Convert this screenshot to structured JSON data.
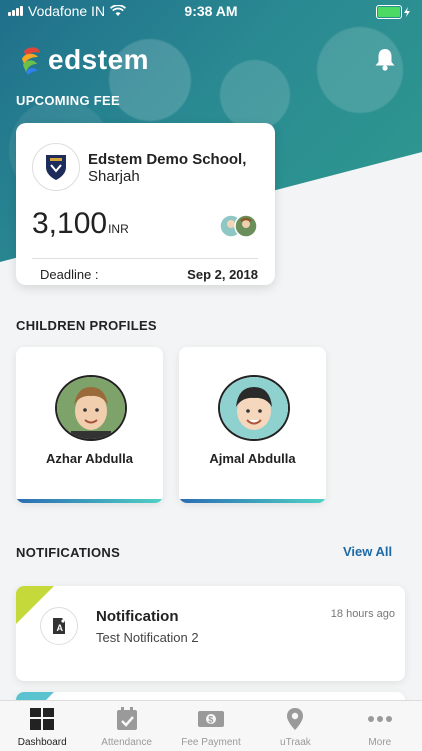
{
  "status_bar": {
    "carrier": "Vodafone IN",
    "time": "9:38 AM"
  },
  "app": {
    "name": "edstem"
  },
  "upcoming_fee": {
    "section_title": "UPCOMING FEE",
    "school_name_bold": "Edstem Demo School,",
    "school_city": "Sharjah",
    "amount": "3,100",
    "currency": "INR",
    "deadline_label": "Deadline :",
    "deadline_value": "Sep 2, 2018"
  },
  "children": {
    "section_title": "CHILDREN PROFILES",
    "items": [
      {
        "name": "Azhar Abdulla"
      },
      {
        "name": "Ajmal Abdulla"
      }
    ]
  },
  "notifications": {
    "section_title": "NOTIFICATIONS",
    "view_all": "View All",
    "items": [
      {
        "title": "Notification",
        "body": "Test Notification 2",
        "time": "18 hours ago"
      }
    ]
  },
  "tabbar": {
    "items": [
      {
        "label": "Dashboard",
        "icon": "dashboard-icon"
      },
      {
        "label": "Attendance",
        "icon": "attendance-icon"
      },
      {
        "label": "Fee Payment",
        "icon": "fee-payment-icon"
      },
      {
        "label": "uTraak",
        "icon": "location-pin-icon"
      },
      {
        "label": "More",
        "icon": "more-icon"
      }
    ]
  },
  "colors": {
    "accent": "#1e6aa6",
    "hero": "#2a8a92",
    "notif_corner": "#c6d93a",
    "gradient_start": "#2b6db3",
    "gradient_end": "#4fd1c5"
  }
}
